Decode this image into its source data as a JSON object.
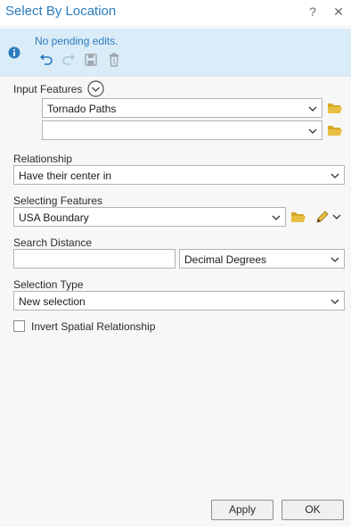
{
  "window": {
    "title": "Select By Location",
    "help_glyph": "?",
    "close_glyph": "✕"
  },
  "infobar": {
    "message": "No pending edits."
  },
  "input_features": {
    "label": "Input Features",
    "rows": [
      {
        "value": "Tornado Paths"
      },
      {
        "value": ""
      }
    ]
  },
  "relationship": {
    "label": "Relationship",
    "value": "Have their center in"
  },
  "selecting_features": {
    "label": "Selecting Features",
    "value": "USA Boundary"
  },
  "search_distance": {
    "label": "Search Distance",
    "value": "",
    "units": "Decimal Degrees"
  },
  "selection_type": {
    "label": "Selection Type",
    "value": "New selection"
  },
  "invert": {
    "label": "Invert Spatial Relationship",
    "checked": false
  },
  "buttons": {
    "apply": "Apply",
    "ok": "OK"
  },
  "colors": {
    "accent": "#2c7bbf",
    "info_bg": "#d9ecf7",
    "folder": "#d7a928"
  }
}
